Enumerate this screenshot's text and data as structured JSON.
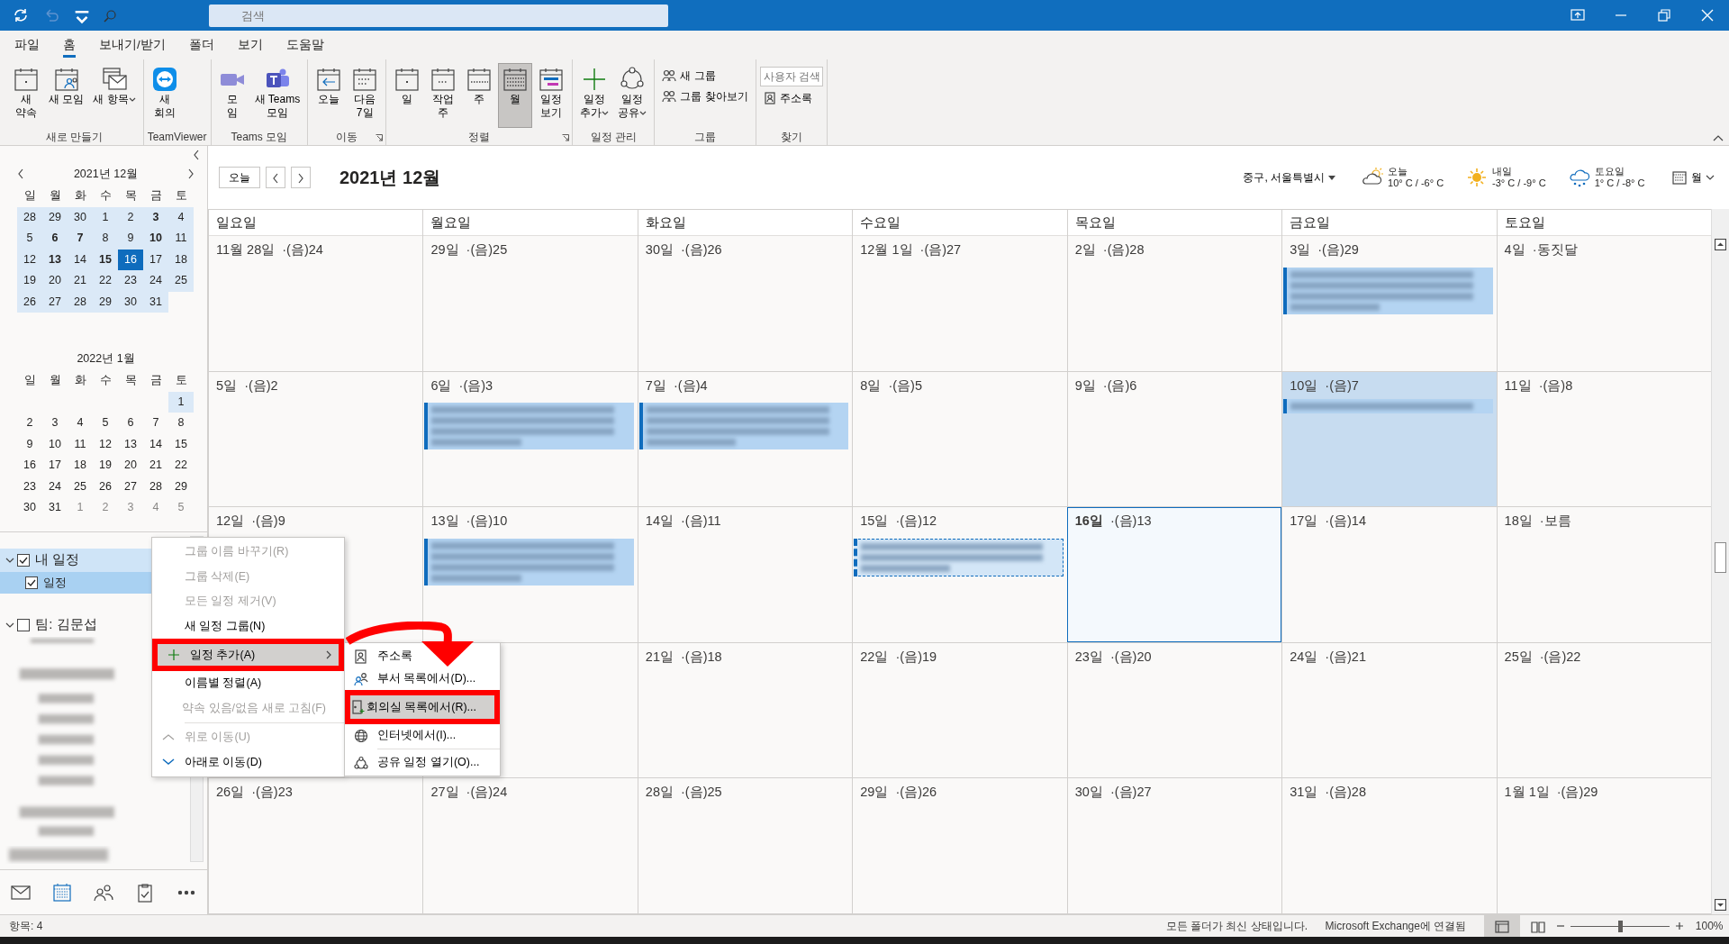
{
  "title_bar": {
    "search": {
      "placeholder": "검색"
    },
    "undo_disabled": true
  },
  "menu_tabs": [
    {
      "label": "파일",
      "selected": false
    },
    {
      "label": "홈",
      "selected": true
    },
    {
      "label": "보내기/받기",
      "selected": false
    },
    {
      "label": "폴더",
      "selected": false
    },
    {
      "label": "보기",
      "selected": false
    },
    {
      "label": "도움말",
      "selected": false
    }
  ],
  "ribbon": [
    {
      "title": "새로 만들기",
      "buttons": [
        {
          "label": "새\n약속",
          "dropdown": false,
          "selected": false
        },
        {
          "label": "새 모임",
          "dropdown": false,
          "selected": false
        },
        {
          "label": "새 항목",
          "dropdown": true,
          "selected": false
        }
      ]
    },
    {
      "title": "TeamViewer",
      "buttons": [
        {
          "label": "새\n회의",
          "dropdown": false,
          "selected": false
        }
      ]
    },
    {
      "title": "Teams 모임",
      "buttons": [
        {
          "label": "모\n임",
          "dropdown": false,
          "selected": false
        },
        {
          "label": "새 Teams\n모임",
          "dropdown": false,
          "selected": false
        }
      ]
    },
    {
      "title": "이동",
      "launcher": true,
      "buttons": [
        {
          "label": "오늘",
          "dropdown": false,
          "selected": false
        },
        {
          "label": "다음\n7일",
          "dropdown": false,
          "selected": false
        }
      ]
    },
    {
      "title": "정렬",
      "launcher": true,
      "buttons": [
        {
          "label": "일",
          "dropdown": false,
          "selected": false
        },
        {
          "label": "작업\n주",
          "dropdown": false,
          "selected": false
        },
        {
          "label": "주",
          "dropdown": false,
          "selected": false
        },
        {
          "label": "월",
          "dropdown": false,
          "selected": true
        },
        {
          "label": "일정\n보기",
          "dropdown": false,
          "selected": false
        }
      ]
    },
    {
      "title": "일정 관리",
      "buttons": [
        {
          "label": "일정\n추가",
          "dropdown": true,
          "selected": false
        },
        {
          "label": "일정\n공유",
          "dropdown": true,
          "selected": false
        }
      ]
    },
    {
      "title": "그룹",
      "small_buttons": [
        {
          "label": "새 그룹"
        },
        {
          "label": "그룹 찾아보기"
        }
      ]
    },
    {
      "title": "찾기",
      "search": {
        "placeholder": "사용자 검색"
      },
      "small_buttons": [
        {
          "label": "주소록"
        }
      ]
    }
  ],
  "mini_calendars": [
    {
      "title": "2021년 12월",
      "weekdays": [
        "일",
        "월",
        "화",
        "수",
        "목",
        "금",
        "토"
      ],
      "weeks": [
        [
          {
            "day": "28",
            "bold": false,
            "selected": false,
            "in_view": true,
            "muted": false
          },
          {
            "day": "29",
            "bold": false,
            "selected": false,
            "in_view": true,
            "muted": false
          },
          {
            "day": "30",
            "bold": false,
            "selected": false,
            "in_view": true,
            "muted": false
          },
          {
            "day": "1",
            "bold": false,
            "selected": false,
            "in_view": true,
            "muted": false
          },
          {
            "day": "2",
            "bold": false,
            "selected": false,
            "in_view": true,
            "muted": false
          },
          {
            "day": "3",
            "bold": true,
            "selected": false,
            "in_view": true,
            "muted": false
          },
          {
            "day": "4",
            "bold": false,
            "selected": false,
            "in_view": true,
            "muted": false
          }
        ],
        [
          {
            "day": "5",
            "bold": false,
            "selected": false,
            "in_view": true,
            "muted": false
          },
          {
            "day": "6",
            "bold": true,
            "selected": false,
            "in_view": true,
            "muted": false
          },
          {
            "day": "7",
            "bold": true,
            "selected": false,
            "in_view": true,
            "muted": false
          },
          {
            "day": "8",
            "bold": false,
            "selected": false,
            "in_view": true,
            "muted": false
          },
          {
            "day": "9",
            "bold": false,
            "selected": false,
            "in_view": true,
            "muted": false
          },
          {
            "day": "10",
            "bold": true,
            "selected": false,
            "in_view": true,
            "muted": false
          },
          {
            "day": "11",
            "bold": false,
            "selected": false,
            "in_view": true,
            "muted": false
          }
        ],
        [
          {
            "day": "12",
            "bold": false,
            "selected": false,
            "in_view": true,
            "muted": false
          },
          {
            "day": "13",
            "bold": true,
            "selected": false,
            "in_view": true,
            "muted": false
          },
          {
            "day": "14",
            "bold": false,
            "selected": false,
            "in_view": true,
            "muted": false
          },
          {
            "day": "15",
            "bold": true,
            "selected": false,
            "in_view": true,
            "muted": false
          },
          {
            "day": "16",
            "bold": false,
            "selected": true,
            "in_view": true,
            "muted": false
          },
          {
            "day": "17",
            "bold": false,
            "selected": false,
            "in_view": true,
            "muted": false
          },
          {
            "day": "18",
            "bold": false,
            "selected": false,
            "in_view": true,
            "muted": false
          }
        ],
        [
          {
            "day": "19",
            "bold": false,
            "selected": false,
            "in_view": true,
            "muted": false
          },
          {
            "day": "20",
            "bold": false,
            "selected": false,
            "in_view": true,
            "muted": false
          },
          {
            "day": "21",
            "bold": false,
            "selected": false,
            "in_view": true,
            "muted": false
          },
          {
            "day": "22",
            "bold": false,
            "selected": false,
            "in_view": true,
            "muted": false
          },
          {
            "day": "23",
            "bold": false,
            "selected": false,
            "in_view": true,
            "muted": false
          },
          {
            "day": "24",
            "bold": false,
            "selected": false,
            "in_view": true,
            "muted": false
          },
          {
            "day": "25",
            "bold": false,
            "selected": false,
            "in_view": true,
            "muted": false
          }
        ],
        [
          {
            "day": "26",
            "bold": false,
            "selected": false,
            "in_view": true,
            "muted": false
          },
          {
            "day": "27",
            "bold": false,
            "selected": false,
            "in_view": true,
            "muted": false
          },
          {
            "day": "28",
            "bold": false,
            "selected": false,
            "in_view": true,
            "muted": false
          },
          {
            "day": "29",
            "bold": false,
            "selected": false,
            "in_view": true,
            "muted": false
          },
          {
            "day": "30",
            "bold": false,
            "selected": false,
            "in_view": true,
            "muted": false
          },
          {
            "day": "31",
            "bold": false,
            "selected": false,
            "in_view": true,
            "muted": false
          }
        ]
      ]
    },
    {
      "title": "2022년 1월",
      "weekdays": [
        "일",
        "월",
        "화",
        "수",
        "목",
        "금",
        "토"
      ],
      "weeks": [
        [
          {
            "day": "1",
            "bold": false,
            "selected": false,
            "in_view": true,
            "muted": false
          }
        ],
        [
          {
            "day": "2",
            "bold": false,
            "selected": false,
            "in_view": false,
            "muted": false
          },
          {
            "day": "3",
            "bold": false,
            "selected": false,
            "in_view": false,
            "muted": false
          },
          {
            "day": "4",
            "bold": false,
            "selected": false,
            "in_view": false,
            "muted": false
          },
          {
            "day": "5",
            "bold": false,
            "selected": false,
            "in_view": false,
            "muted": false
          },
          {
            "day": "6",
            "bold": false,
            "selected": false,
            "in_view": false,
            "muted": false
          },
          {
            "day": "7",
            "bold": false,
            "selected": false,
            "in_view": false,
            "muted": false
          },
          {
            "day": "8",
            "bold": false,
            "selected": false,
            "in_view": false,
            "muted": false
          }
        ],
        [
          {
            "day": "9",
            "bold": false,
            "selected": false,
            "in_view": false,
            "muted": false
          },
          {
            "day": "10",
            "bold": false,
            "selected": false,
            "in_view": false,
            "muted": false
          },
          {
            "day": "11",
            "bold": false,
            "selected": false,
            "in_view": false,
            "muted": false
          },
          {
            "day": "12",
            "bold": false,
            "selected": false,
            "in_view": false,
            "muted": false
          },
          {
            "day": "13",
            "bold": false,
            "selected": false,
            "in_view": false,
            "muted": false
          },
          {
            "day": "14",
            "bold": false,
            "selected": false,
            "in_view": false,
            "muted": false
          },
          {
            "day": "15",
            "bold": false,
            "selected": false,
            "in_view": false,
            "muted": false
          }
        ],
        [
          {
            "day": "16",
            "bold": false,
            "selected": false,
            "in_view": false,
            "muted": false
          },
          {
            "day": "17",
            "bold": false,
            "selected": false,
            "in_view": false,
            "muted": false
          },
          {
            "day": "18",
            "bold": false,
            "selected": false,
            "in_view": false,
            "muted": false
          },
          {
            "day": "19",
            "bold": false,
            "selected": false,
            "in_view": false,
            "muted": false
          },
          {
            "day": "20",
            "bold": false,
            "selected": false,
            "in_view": false,
            "muted": false
          },
          {
            "day": "21",
            "bold": false,
            "selected": false,
            "in_view": false,
            "muted": false
          },
          {
            "day": "22",
            "bold": false,
            "selected": false,
            "in_view": false,
            "muted": false
          }
        ],
        [
          {
            "day": "23",
            "bold": false,
            "selected": false,
            "in_view": false,
            "muted": false
          },
          {
            "day": "24",
            "bold": false,
            "selected": false,
            "in_view": false,
            "muted": false
          },
          {
            "day": "25",
            "bold": false,
            "selected": false,
            "in_view": false,
            "muted": false
          },
          {
            "day": "26",
            "bold": false,
            "selected": false,
            "in_view": false,
            "muted": false
          },
          {
            "day": "27",
            "bold": false,
            "selected": false,
            "in_view": false,
            "muted": false
          },
          {
            "day": "28",
            "bold": false,
            "selected": false,
            "in_view": false,
            "muted": false
          },
          {
            "day": "29",
            "bold": false,
            "selected": false,
            "in_view": false,
            "muted": false
          }
        ],
        [
          {
            "day": "30",
            "bold": false,
            "selected": false,
            "in_view": false,
            "muted": false
          },
          {
            "day": "31",
            "bold": false,
            "selected": false,
            "in_view": false,
            "muted": false
          },
          {
            "day": "1",
            "bold": false,
            "selected": false,
            "in_view": false,
            "muted": true
          },
          {
            "day": "2",
            "bold": false,
            "selected": false,
            "in_view": false,
            "muted": true
          },
          {
            "day": "3",
            "bold": false,
            "selected": false,
            "in_view": false,
            "muted": true
          },
          {
            "day": "4",
            "bold": false,
            "selected": false,
            "in_view": false,
            "muted": true
          },
          {
            "day": "5",
            "bold": false,
            "selected": false,
            "in_view": false,
            "muted": true
          }
        ]
      ]
    }
  ],
  "folders": [
    {
      "label": "내 일정",
      "checked": true,
      "expanded": true,
      "selected": true,
      "children": [
        {
          "label": "일정",
          "checked": true,
          "selected": true
        }
      ]
    },
    {
      "label": "팀: 김문섭",
      "checked": false,
      "expanded": true,
      "selected": false
    }
  ],
  "nav": [
    {
      "kind": "mail",
      "selected": false
    },
    {
      "kind": "calendar",
      "selected": true
    },
    {
      "kind": "people",
      "selected": false
    },
    {
      "kind": "tasks",
      "selected": false
    },
    {
      "kind": "more",
      "selected": false
    }
  ],
  "calendar": {
    "today_button": "오늘",
    "title": "2021년 12월",
    "location": "중구, 서울특별시",
    "weather": [
      {
        "day": "오늘",
        "temp": "10° C / -6° C",
        "kind": "partly-cloudy"
      },
      {
        "day": "내일",
        "temp": "-3° C / -9° C",
        "kind": "sunny"
      },
      {
        "day": "토요일",
        "temp": "1° C / -8° C",
        "kind": "snow"
      }
    ],
    "view": "월",
    "weekdays": [
      "일요일",
      "월요일",
      "화요일",
      "수요일",
      "목요일",
      "금요일",
      "토요일"
    ],
    "weeks": [
      [
        {
          "date": "11월 28일",
          "lunar": "·(음)24",
          "today": false,
          "highlighted": false
        },
        {
          "date": "29일",
          "lunar": "·(음)25",
          "today": false,
          "highlighted": false
        },
        {
          "date": "30일",
          "lunar": "·(음)26",
          "today": false,
          "highlighted": false
        },
        {
          "date": "12월 1일",
          "lunar": "·(음)27",
          "today": false,
          "highlighted": false
        },
        {
          "date": "2일",
          "lunar": "·(음)28",
          "today": false,
          "highlighted": false
        },
        {
          "date": "3일",
          "lunar": "·(음)29",
          "today": false,
          "highlighted": false,
          "events": [
            {
              "kind": "busy"
            }
          ]
        },
        {
          "date": "4일",
          "lunar": "·동짓달",
          "today": false,
          "highlighted": false
        }
      ],
      [
        {
          "date": "5일",
          "lunar": "·(음)2",
          "today": false,
          "highlighted": false
        },
        {
          "date": "6일",
          "lunar": "·(음)3",
          "today": false,
          "highlighted": false,
          "events": [
            {
              "kind": "busy"
            }
          ]
        },
        {
          "date": "7일",
          "lunar": "·(음)4",
          "today": false,
          "highlighted": false,
          "events": [
            {
              "kind": "busy"
            }
          ]
        },
        {
          "date": "8일",
          "lunar": "·(음)5",
          "today": false,
          "highlighted": false
        },
        {
          "date": "9일",
          "lunar": "·(음)6",
          "today": false,
          "highlighted": false
        },
        {
          "date": "10일",
          "lunar": "·(음)7",
          "today": false,
          "highlighted": true,
          "events": [
            {
              "kind": "brief"
            }
          ]
        },
        {
          "date": "11일",
          "lunar": "·(음)8",
          "today": false,
          "highlighted": false
        }
      ],
      [
        {
          "date": "12일",
          "lunar": "·(음)9",
          "today": false,
          "highlighted": false
        },
        {
          "date": "13일",
          "lunar": "·(음)10",
          "today": false,
          "highlighted": false,
          "events": [
            {
              "kind": "busy"
            }
          ]
        },
        {
          "date": "14일",
          "lunar": "·(음)11",
          "today": false,
          "highlighted": false
        },
        {
          "date": "15일",
          "lunar": "·(음)12",
          "today": false,
          "highlighted": false,
          "events": [
            {
              "kind": "tentative"
            }
          ]
        },
        {
          "date": "16일",
          "lunar": "·(음)13",
          "today": true,
          "highlighted": false
        },
        {
          "date": "17일",
          "lunar": "·(음)14",
          "today": false,
          "highlighted": false
        },
        {
          "date": "18일",
          "lunar": "·보름",
          "today": false,
          "highlighted": false
        }
      ],
      [
        {
          "today": false,
          "highlighted": false
        },
        {
          "today": false,
          "highlighted": false
        },
        {
          "date": "21일",
          "lunar": "·(음)18",
          "today": false,
          "highlighted": false
        },
        {
          "date": "22일",
          "lunar": "·(음)19",
          "today": false,
          "highlighted": false
        },
        {
          "date": "23일",
          "lunar": "·(음)20",
          "today": false,
          "highlighted": false
        },
        {
          "date": "24일",
          "lunar": "·(음)21",
          "today": false,
          "highlighted": false
        },
        {
          "date": "25일",
          "lunar": "·(음)22",
          "today": false,
          "highlighted": false
        }
      ],
      [
        {
          "date": "26일",
          "lunar": "·(음)23",
          "today": false,
          "highlighted": false
        },
        {
          "date": "27일",
          "lunar": "·(음)24",
          "today": false,
          "highlighted": false
        },
        {
          "date": "28일",
          "lunar": "·(음)25",
          "today": false,
          "highlighted": false
        },
        {
          "date": "29일",
          "lunar": "·(음)26",
          "today": false,
          "highlighted": false
        },
        {
          "date": "30일",
          "lunar": "·(음)27",
          "today": false,
          "highlighted": false
        },
        {
          "date": "31일",
          "lunar": "·(음)28",
          "today": false,
          "highlighted": false
        },
        {
          "date": "1월 1일",
          "lunar": "·(음)29",
          "today": false,
          "highlighted": false
        }
      ]
    ]
  },
  "context_menu": {
    "items": [
      {
        "label": "그룹 이름 바꾸기(R)",
        "disabled": true,
        "selected": false,
        "framed": false,
        "kind": "plain"
      },
      {
        "label": "그룹 삭제(E)",
        "disabled": true,
        "selected": false,
        "framed": false,
        "kind": "plain"
      },
      {
        "label": "모든 일정 제거(V)",
        "disabled": true,
        "selected": false,
        "framed": false,
        "kind": "plain"
      },
      {
        "label": "새 일정 그룹(N)",
        "disabled": false,
        "selected": false,
        "framed": false,
        "kind": "plain"
      },
      {
        "label": "일정 추가(A)",
        "disabled": false,
        "selected": true,
        "framed": true,
        "kind": "submenu"
      },
      {
        "label": "이름별 정렬(A)",
        "disabled": false,
        "selected": false,
        "framed": false,
        "kind": "plain"
      },
      {
        "label": "약속 있음/없음 새로 고침(F)",
        "disabled": true,
        "selected": false,
        "framed": false,
        "kind": "plain"
      },
      {
        "label": "위로 이동(U)",
        "disabled": true,
        "selected": false,
        "framed": false,
        "kind": "up"
      },
      {
        "label": "아래로 이동(D)",
        "disabled": false,
        "selected": false,
        "framed": false,
        "kind": "down"
      }
    ],
    "submenu": [
      {
        "label": "주소록",
        "kind": "address-book",
        "selected": false,
        "framed": false
      },
      {
        "label": "부서 목록에서(D)...",
        "kind": "department",
        "selected": false,
        "framed": false
      },
      {
        "label": "회의실 목록에서(R)...",
        "kind": "room",
        "selected": true,
        "framed": true
      },
      {
        "label": "인터넷에서(I)...",
        "kind": "internet",
        "selected": false,
        "framed": false
      },
      {
        "label": "공유 일정 열기(O)...",
        "kind": "shared",
        "selected": false,
        "framed": false
      }
    ]
  },
  "status_bar": {
    "items": "항목: 4",
    "sync": "모든 폴더가 최신 상태입니다.",
    "connection": "Microsoft Exchange에 연결됨",
    "view_buttons": [
      {
        "kind": "normal",
        "selected": true
      },
      {
        "kind": "reading",
        "selected": false
      }
    ],
    "zoom": {
      "level": 0.5,
      "reading": "100%"
    }
  }
}
